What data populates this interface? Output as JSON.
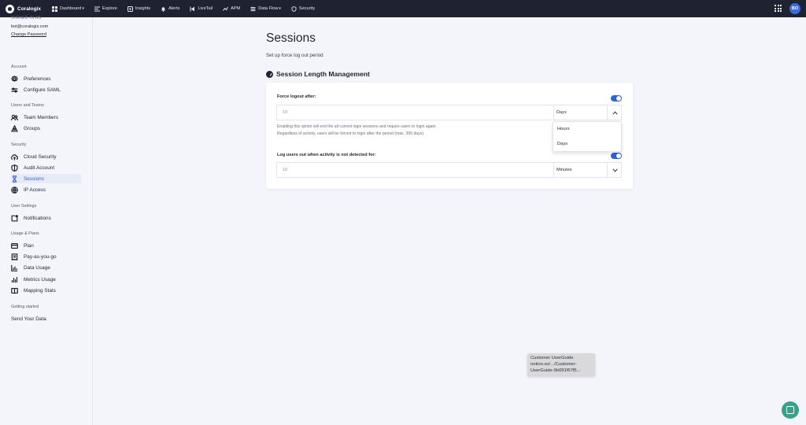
{
  "topnav": {
    "brand": "Coralogix",
    "items": [
      {
        "label": "Dashboard",
        "icon": "dashboard-icon",
        "caret": "▾"
      },
      {
        "label": "Explore",
        "icon": "explore-icon",
        "caret": ""
      },
      {
        "label": "Insights",
        "icon": "insights-icon",
        "caret": ""
      },
      {
        "label": "Alerts",
        "icon": "bell-icon",
        "caret": ""
      },
      {
        "label": "LiveTail",
        "icon": "livetail-icon",
        "caret": ""
      },
      {
        "label": "APM",
        "icon": "apm-icon",
        "caret": ""
      },
      {
        "label": "Data Flow",
        "icon": "dataflow-icon",
        "caret": "▾"
      },
      {
        "label": "Security",
        "icon": "shield-icon",
        "caret": ""
      }
    ],
    "avatar_initials": "BO"
  },
  "sidebar": {
    "signed_in_label": "SIGNED IN AS",
    "email": "bot@coralogix.com",
    "change_password": "Change Password",
    "sections": {
      "account": "Account",
      "users_teams": "Users and Teams",
      "security": "Security",
      "user_settings": "User Settings",
      "usage_plans": "Usage & Plans",
      "getting_started": "Getting started"
    },
    "items": {
      "preferences": "Preferences",
      "configure_saml": "Configure SAML",
      "team_members": "Team Members",
      "groups": "Groups",
      "cloud_security": "Cloud Security",
      "audit_account": "Audit Account",
      "sessions": "Sessions",
      "ip_access": "IP Access",
      "notifications": "Notifications",
      "plan": "Plan",
      "pay_as_you_go": "Pay-as-you-go",
      "data_usage": "Data Usage",
      "metrics_usage": "Metrics Usage",
      "mapping_stats": "Mapping Stats",
      "send_your_data": "Send Your Data"
    }
  },
  "main": {
    "title": "Sessions",
    "subtitle": "Set up force log out period",
    "section_title": "Session Length Management",
    "force_logout": {
      "label": "Force logout after:",
      "value": "10",
      "unit": "Days",
      "enabled": true,
      "help_line1": "Enabling this option will end the all current login sessions and require users to login again.",
      "help_line2": "Regardless of activity, users will be forced to login after the period (max. 365 days).",
      "dropdown_options": [
        "Hours",
        "Days"
      ]
    },
    "inactivity": {
      "label": "Log users out when activity is not detected for:",
      "value": "10",
      "unit": "Minutes",
      "enabled": true
    }
  },
  "tooltip": {
    "line1": "Customer UserGuide",
    "line2": "notion.so/.../Customer-",
    "line3": "UserGuide-9b091f67f5..."
  },
  "colors": {
    "accent": "#2f62d6",
    "topbar": "#1e2231",
    "chat": "#3aa08a"
  }
}
